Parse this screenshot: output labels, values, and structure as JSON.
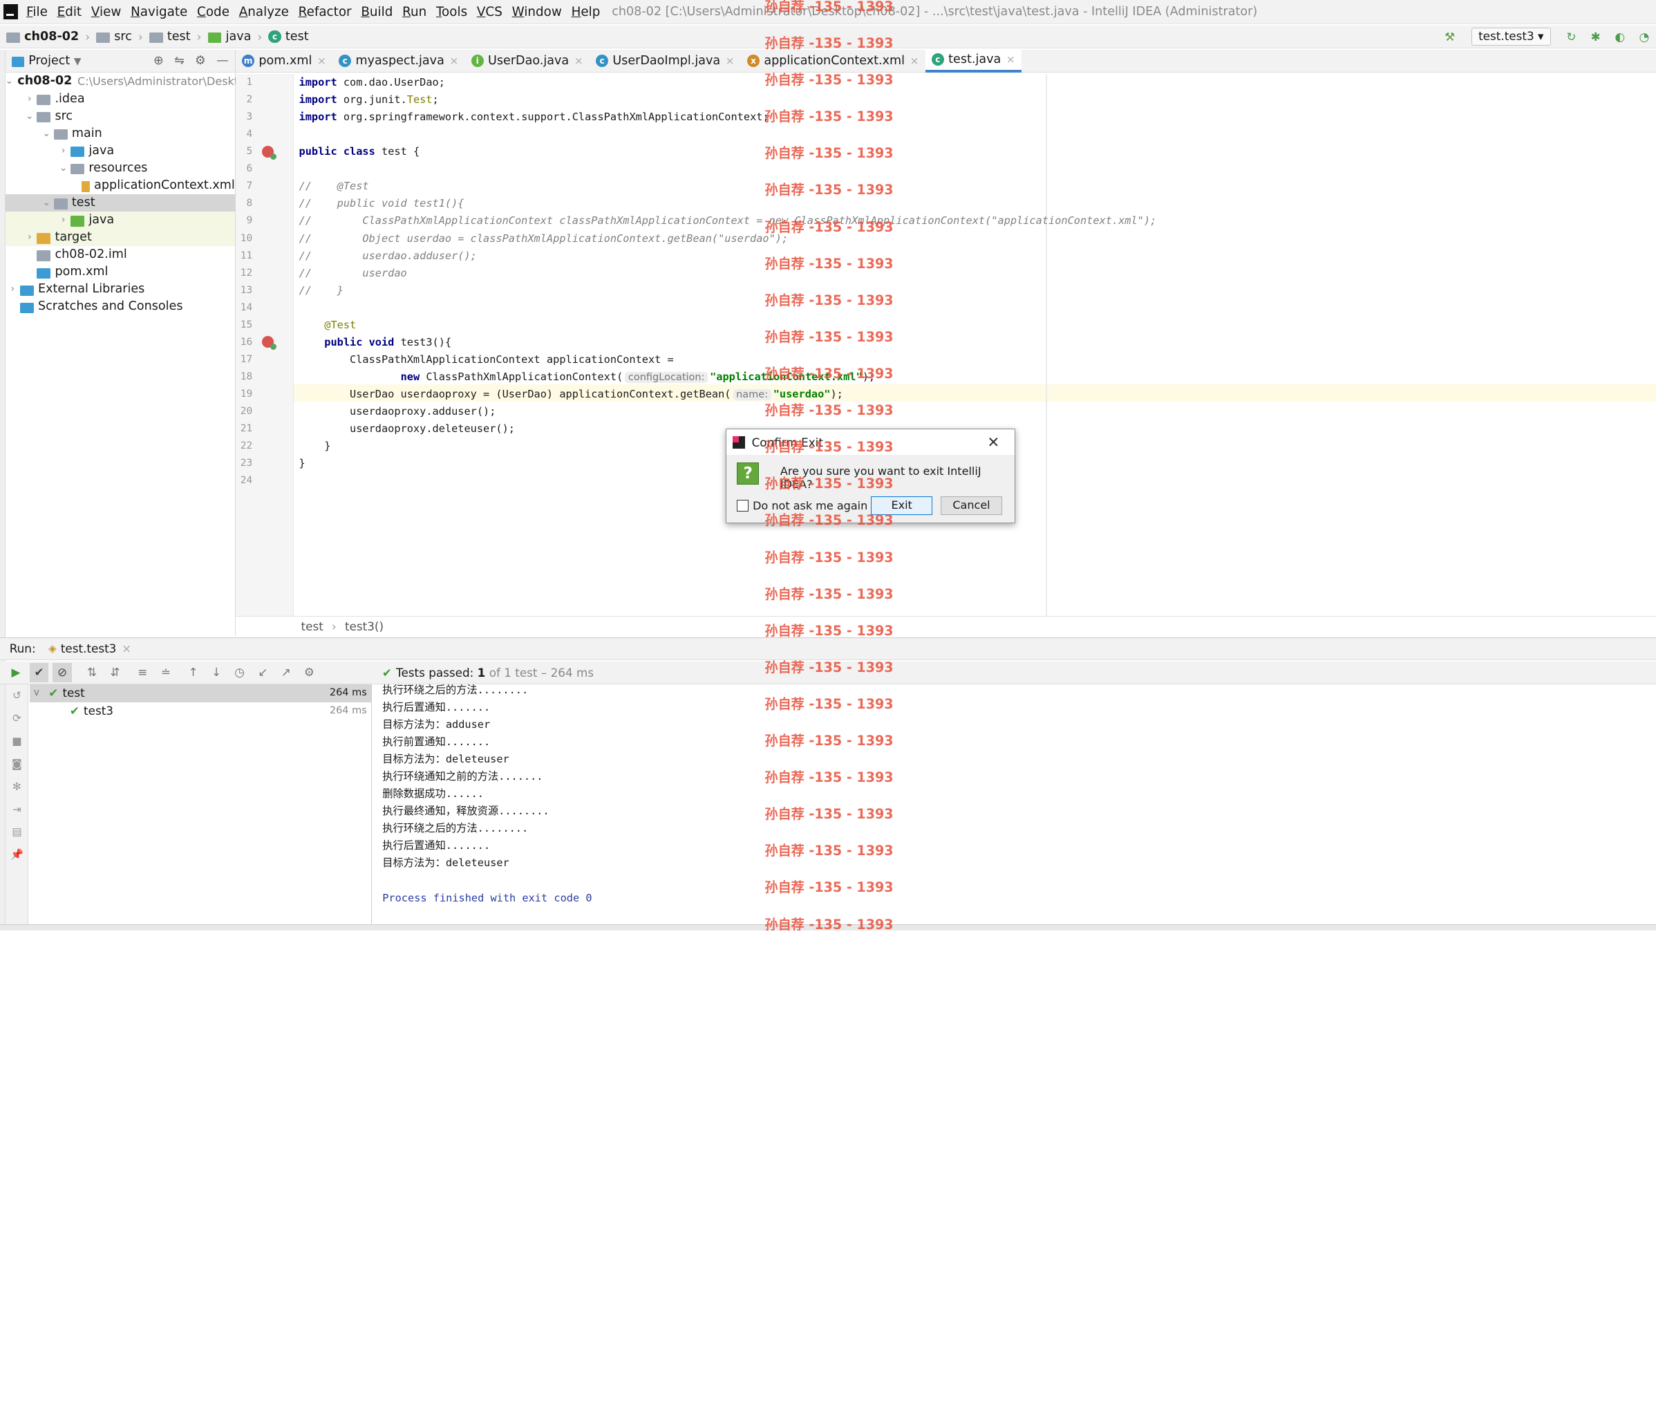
{
  "menubar": {
    "items": [
      "File",
      "Edit",
      "View",
      "Navigate",
      "Code",
      "Analyze",
      "Refactor",
      "Build",
      "Run",
      "Tools",
      "VCS",
      "Window",
      "Help"
    ],
    "window_title": "ch08-02 [C:\\Users\\Administrator\\Desktop\\ch08-02] - ...\\src\\test\\java\\test.java - IntelliJ IDEA (Administrator)"
  },
  "navbar": {
    "crumbs": [
      "ch08-02",
      "src",
      "test",
      "java",
      "test"
    ],
    "run_config": "test.test3"
  },
  "project": {
    "title": "Project",
    "tree": [
      {
        "label": "ch08-02",
        "extra": "C:\\Users\\Administrator\\Deskt",
        "depth": 0,
        "arrow": "v",
        "icon": "folder"
      },
      {
        "label": ".idea",
        "depth": 1,
        "arrow": ">",
        "icon": "folder"
      },
      {
        "label": "src",
        "depth": 1,
        "arrow": "v",
        "icon": "folder"
      },
      {
        "label": "main",
        "depth": 2,
        "arrow": "v",
        "icon": "folder"
      },
      {
        "label": "java",
        "depth": 3,
        "arrow": ">",
        "icon": "folder-blue"
      },
      {
        "label": "resources",
        "depth": 3,
        "arrow": "v",
        "icon": "folder"
      },
      {
        "label": "applicationContext.xml",
        "depth": 4,
        "arrow": "",
        "icon": "xml"
      },
      {
        "label": "test",
        "depth": 2,
        "arrow": "v",
        "icon": "folder",
        "state": "selected"
      },
      {
        "label": "java",
        "depth": 3,
        "arrow": ">",
        "icon": "folder-green",
        "state": "highlight"
      },
      {
        "label": "target",
        "depth": 1,
        "arrow": ">",
        "icon": "folder-orange",
        "state": "highlight"
      },
      {
        "label": "ch08-02.iml",
        "depth": 1,
        "arrow": "",
        "icon": "file"
      },
      {
        "label": "pom.xml",
        "depth": 1,
        "arrow": "",
        "icon": "maven"
      },
      {
        "label": "External Libraries",
        "depth": 0,
        "arrow": ">",
        "icon": "lib"
      },
      {
        "label": "Scratches and Consoles",
        "depth": 0,
        "arrow": "",
        "icon": "scratch"
      }
    ]
  },
  "tabs": [
    {
      "label": "pom.xml",
      "icon": "m",
      "color": "#3d7dca"
    },
    {
      "label": "myaspect.java",
      "icon": "c",
      "color": "#3592c4"
    },
    {
      "label": "UserDao.java",
      "icon": "i",
      "color": "#62b543"
    },
    {
      "label": "UserDaoImpl.java",
      "icon": "c",
      "color": "#3592c4"
    },
    {
      "label": "applicationContext.xml",
      "icon": "x",
      "color": "#d08a28"
    },
    {
      "label": "test.java",
      "icon": "c",
      "color": "#2fa37a",
      "active": true
    }
  ],
  "code_lines": [
    [
      [
        "kw",
        "import"
      ],
      [
        "",
        "com.dao.UserDao;"
      ]
    ],
    [
      [
        "kw",
        "import"
      ],
      [
        "",
        "org.junit."
      ],
      [
        "ann",
        "Test"
      ],
      [
        "",
        ";"
      ]
    ],
    [
      [
        "kw",
        "import"
      ],
      [
        "",
        "org.springframework.context.support.ClassPathXmlApplicationContext;"
      ]
    ],
    [],
    [
      [
        "kw",
        "public class"
      ],
      [
        "",
        "test {"
      ]
    ],
    [],
    [
      [
        "cmt",
        "//    @Test"
      ]
    ],
    [
      [
        "cmt",
        "//    public void test1(){"
      ]
    ],
    [
      [
        "cmt",
        "//        ClassPathXmlApplicationContext classPathXmlApplicationContext = new ClassPathXmlApplicationContext(\"applicationContext.xml\");"
      ]
    ],
    [
      [
        "cmt",
        "//        Object userdao = classPathXmlApplicationContext.getBean(\"userdao\");"
      ]
    ],
    [
      [
        "cmt",
        "//        userdao.adduser();"
      ]
    ],
    [
      [
        "cmt",
        "//        userdao"
      ]
    ],
    [
      [
        "cmt",
        "//    }"
      ]
    ],
    [],
    [
      [
        "ann",
        "    @Test"
      ]
    ],
    [
      [
        "kw",
        "    public void"
      ],
      [
        "",
        "test3(){"
      ]
    ],
    [
      [
        "",
        "        ClassPathXmlApplicationContext applicationContext ="
      ]
    ],
    [
      [
        "",
        "                "
      ],
      [
        "kw",
        "new"
      ],
      [
        "",
        "ClassPathXmlApplicationContext("
      ],
      [
        "hint",
        "configLocation:"
      ],
      [
        "str",
        "\"applicationContext.xml\""
      ],
      [
        "",
        ");"
      ]
    ],
    [
      [
        "",
        "        UserDao userdaoproxy = (UserDao) applicationContext.getBean("
      ],
      [
        "hint",
        "name:"
      ],
      [
        "str",
        "\"userdao\""
      ],
      [
        "",
        ");"
      ]
    ],
    [
      [
        "",
        "        userdaoproxy.adduser();"
      ]
    ],
    [
      [
        "",
        "        userdaoproxy.deleteuser();"
      ]
    ],
    [
      [
        "",
        "    }"
      ]
    ],
    [
      [
        "",
        "}"
      ]
    ],
    []
  ],
  "editor_breadcrumb": [
    "test",
    "test3()"
  ],
  "run": {
    "label": "Run:",
    "tab": "test.test3",
    "status_prefix": "Tests passed:",
    "status_count": "1",
    "status_rest": "of 1 test – 264 ms",
    "tree": [
      {
        "label": "test",
        "time": "264 ms"
      },
      {
        "label": "test3",
        "time": "264 ms"
      }
    ],
    "console": [
      "执行环绕之后的方法........",
      "执行后置通知.......",
      "目标方法为：adduser",
      "执行前置通知.......",
      "目标方法为：deleteuser",
      "执行环绕通知之前的方法.......",
      "删除数据成功......",
      "执行最终通知，释放资源........",
      "执行环绕之后的方法........",
      "执行后置通知.......",
      "目标方法为：deleteuser",
      "",
      "Process finished with exit code 0"
    ]
  },
  "dialog": {
    "title": "Confirm Exit",
    "message": "Are you sure you want to exit IntelliJ IDEA?",
    "checkbox": "Do not ask me again",
    "exit": "Exit",
    "cancel": "Cancel"
  },
  "watermark": "孙自荐 -135 - 1393"
}
